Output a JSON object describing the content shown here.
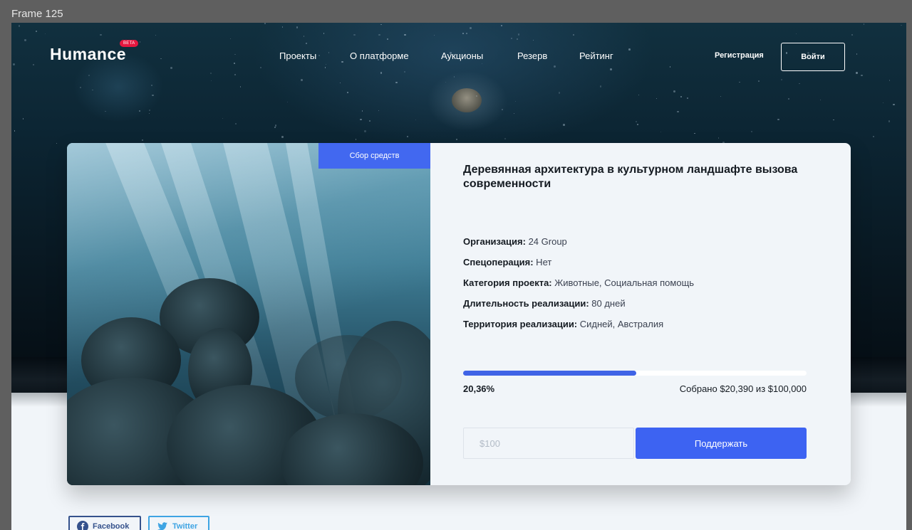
{
  "frame_label": "Frame 125",
  "header": {
    "logo": "Humance",
    "beta_badge": "BETA",
    "nav": [
      "Проекты",
      "О платформе",
      "Аукционы",
      "Резерв",
      "Рейтинг"
    ],
    "register_label": "Регистрация",
    "login_label": "Войти"
  },
  "project": {
    "badge": "Сбор средств",
    "title": "Деревянная архитектура в культурном ландшафте вызова современности",
    "facts": [
      {
        "label": "Организация:",
        "value": " 24 Group"
      },
      {
        "label": "Спецоперация:",
        "value": " Нет"
      },
      {
        "label": "Категория проекта:",
        "value": " Животные, Социальная помощь"
      },
      {
        "label": "Длительность реализации:",
        "value": " 80 дней"
      },
      {
        "label": "Территория реализации:",
        "value": " Сидней, Австралия"
      }
    ],
    "progress_fraction": 0.5036,
    "progress_percent_label": "20,36%",
    "collected_label": "Собрано $20,390 из $100,000",
    "amount_placeholder": "$100",
    "support_label": "Поддержать"
  },
  "share": {
    "facebook_label": "Facebook",
    "twitter_label": "Twitter"
  },
  "colors": {
    "accent": "#3d63f2",
    "beta": "#e5173f",
    "facebook": "#35528c",
    "twitter": "#3ea4e3"
  }
}
